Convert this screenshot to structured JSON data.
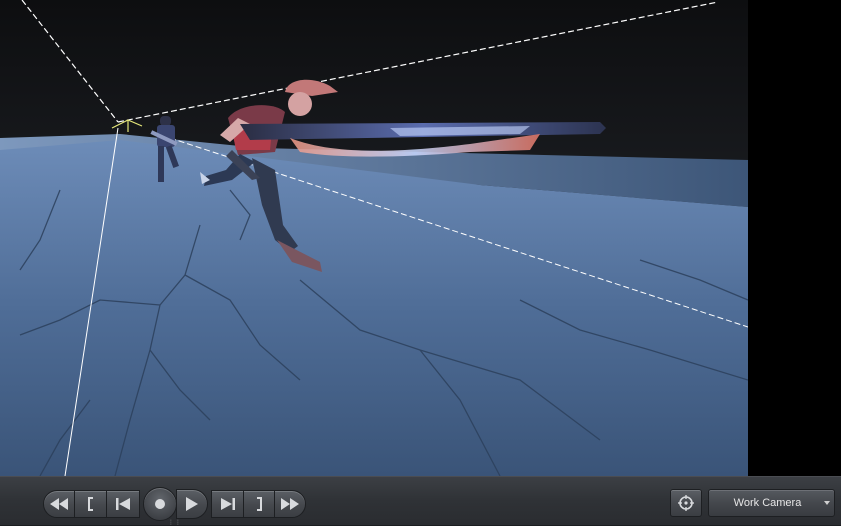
{
  "viewport": {
    "grid_color": "#ffffff",
    "floor_color": "#5b7aa6",
    "sky_color": "#121417"
  },
  "transport": {
    "buttons": [
      {
        "name": "rewind-button",
        "icon": "rewind-icon"
      },
      {
        "name": "mark-in-button",
        "icon": "mark-in-bracket-icon"
      },
      {
        "name": "step-back-button",
        "icon": "skip-back-icon"
      },
      {
        "name": "record-button",
        "icon": "record-dot-icon"
      },
      {
        "name": "play-button",
        "icon": "play-icon"
      },
      {
        "name": "step-forward-button",
        "icon": "skip-forward-icon"
      },
      {
        "name": "mark-out-button",
        "icon": "mark-out-bracket-icon"
      },
      {
        "name": "fast-forward-button",
        "icon": "fast-forward-icon"
      }
    ],
    "camera_target_icon": "crosshair-icon",
    "camera_select": {
      "value": "Work Camera",
      "arrow_icon": "dropdown-arrow-icon"
    }
  }
}
